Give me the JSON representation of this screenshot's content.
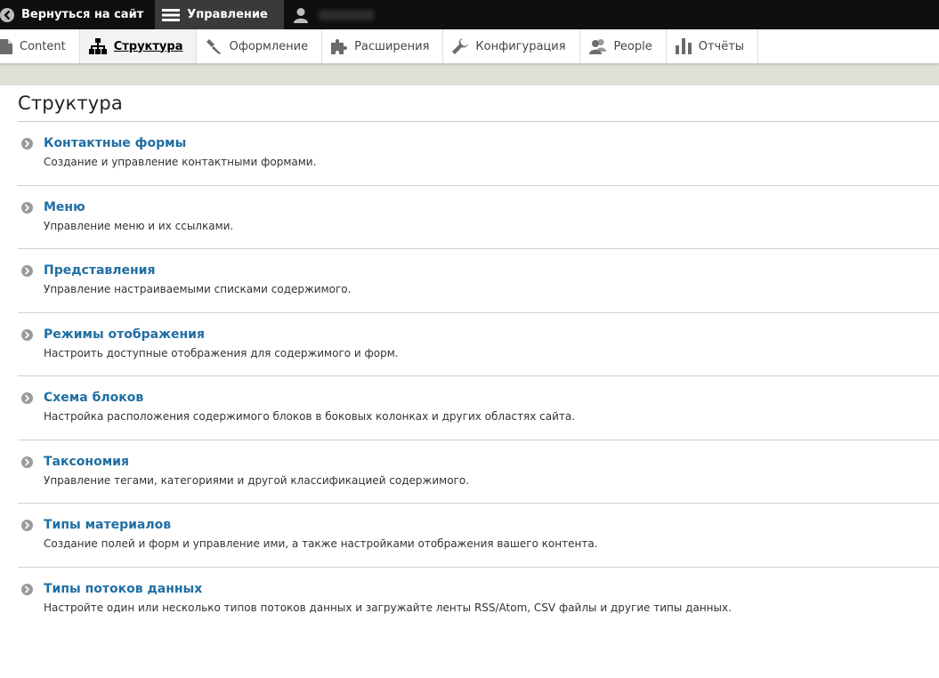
{
  "toolbar": {
    "back_label": "Вернуться на сайт",
    "manage_label": "Управление",
    "user_name": ""
  },
  "tray": {
    "items": [
      {
        "label": "Content",
        "icon": "file-icon"
      },
      {
        "label": "Структура",
        "icon": "sitemap-icon",
        "active": true
      },
      {
        "label": "Оформление",
        "icon": "paintbrush-icon"
      },
      {
        "label": "Расширения",
        "icon": "puzzle-icon"
      },
      {
        "label": "Конфигурация",
        "icon": "wrench-icon"
      },
      {
        "label": "People",
        "icon": "people-icon"
      },
      {
        "label": "Отчёты",
        "icon": "bar-chart-icon"
      }
    ]
  },
  "page": {
    "title": "Структура"
  },
  "entries": [
    {
      "title": "Контактные формы",
      "desc": "Создание и управление контактными формами."
    },
    {
      "title": "Меню",
      "desc": "Управление меню и их ссылками."
    },
    {
      "title": "Представления",
      "desc": "Управление настраиваемыми списками содержимого."
    },
    {
      "title": "Режимы отображения",
      "desc": "Настроить доступные отображения для содержимого и форм."
    },
    {
      "title": "Схема блоков",
      "desc": "Настройка расположения содержимого блоков в боковых колонках и других областях сайта."
    },
    {
      "title": "Таксономия",
      "desc": "Управление тегами, категориями и другой классификацией содержимого."
    },
    {
      "title": "Типы материалов",
      "desc": "Создание полей и форм и управление ими, а также настройками отображения вашего контента."
    },
    {
      "title": "Типы потоков данных",
      "desc": "Настройте один или несколько типов потоков данных и загружайте ленты RSS/Atom, CSV файлы и другие типы данных."
    }
  ],
  "colors": {
    "toolbar_bg": "#0f0f0f",
    "link": "#1f6fa3",
    "strip": "#e0e0d8"
  }
}
